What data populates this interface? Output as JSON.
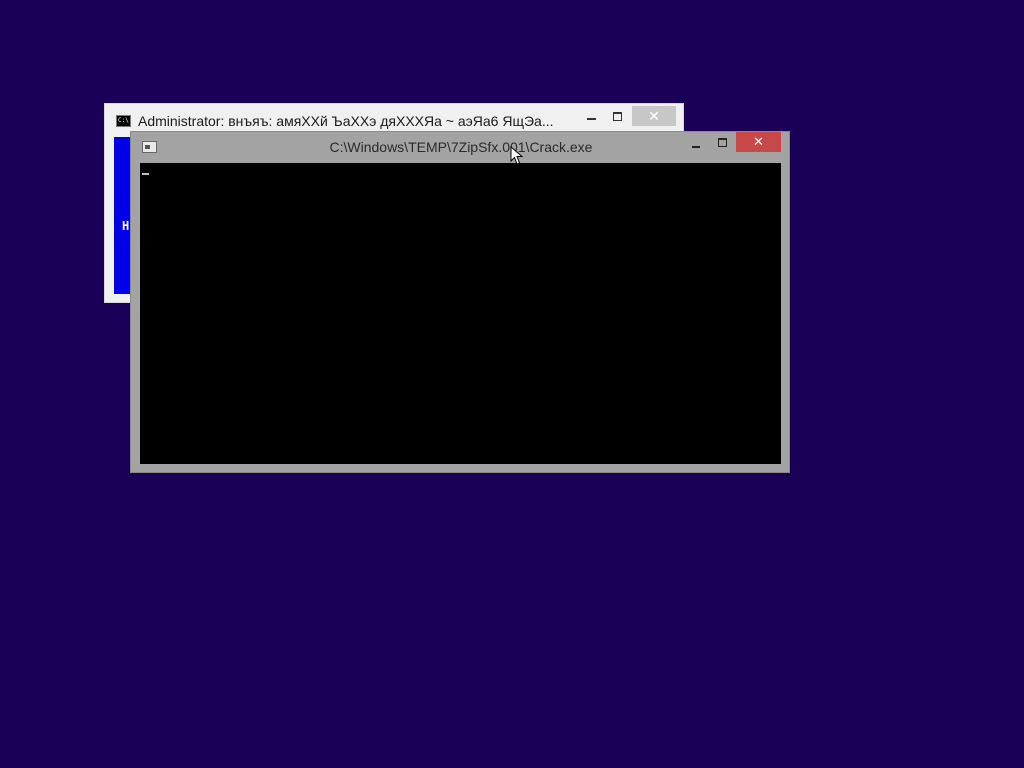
{
  "desktop": {
    "background_color": "#1b0057"
  },
  "back_window": {
    "title": "Administrator:  внъяъ: амяXXй ЪaXXэ дяXXXЯa  ~ аэЯa6 ЯщЭa...",
    "icon": "console-icon",
    "content_char": "H",
    "content_color": "#0000e8",
    "controls": {
      "minimize_icon": "minimize-icon",
      "maximize_icon": "maximize-icon",
      "close_label": "✕"
    }
  },
  "front_window": {
    "title": "C:\\Windows\\TEMP\\7ZipSfx.001\\Crack.exe",
    "icon": "console-icon",
    "console_color": "#000000",
    "controls": {
      "minimize_icon": "minimize-icon",
      "maximize_icon": "maximize-icon",
      "close_label": "✕",
      "close_color": "#c74848"
    }
  },
  "pointer": {
    "icon": "mouse-pointer-icon"
  }
}
